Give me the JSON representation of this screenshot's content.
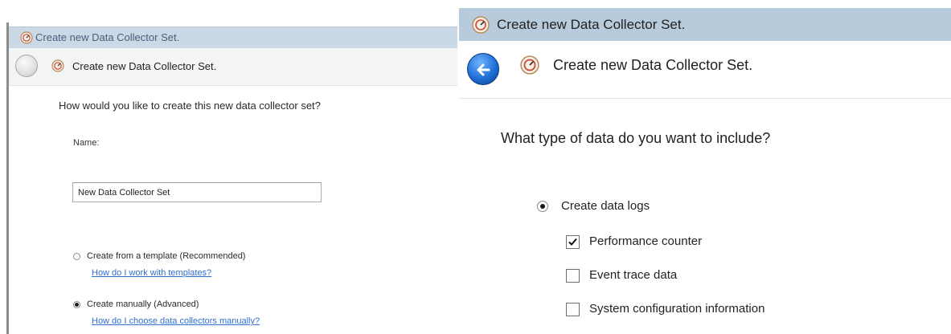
{
  "left_window": {
    "title": "Create new Data Collector Set.",
    "header_title": "Create new Data Collector Set.",
    "question": "How would you like to create this new data collector set?",
    "name_label": "Name:",
    "name_value": "New Data Collector Set",
    "options": [
      {
        "label": "Create from a template (Recommended)",
        "selected": false,
        "help_link": "How do I work with templates?"
      },
      {
        "label": "Create manually (Advanced)",
        "selected": true,
        "help_link": "How do I choose data collectors manually?"
      }
    ]
  },
  "right_window": {
    "title": "Create new Data Collector Set.",
    "header_title": "Create new Data Collector Set.",
    "question": "What type of data do you want to include?",
    "radio_label": "Create data logs",
    "radio_selected": true,
    "checkboxes": [
      {
        "label": "Performance counter",
        "checked": true
      },
      {
        "label": "Event trace data",
        "checked": false
      },
      {
        "label": "System configuration information",
        "checked": false
      }
    ]
  },
  "colors": {
    "titlebar_left": "#cbd9e6",
    "titlebar_right": "#b7cbdc",
    "link": "#2f6fcf",
    "back_button": "#1f6fd6"
  }
}
